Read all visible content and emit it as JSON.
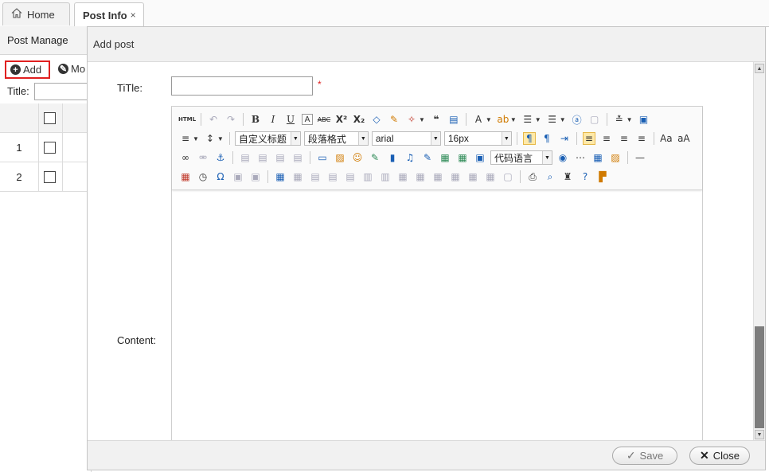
{
  "tabs": [
    {
      "label": "Home",
      "icon": "home-icon"
    },
    {
      "label": "Post Info",
      "close": "×"
    }
  ],
  "left_panel": {
    "title": "Post Manage",
    "add_label": "Add",
    "modify_label": "Mo",
    "filter_label": "Title:",
    "rows": [
      "1",
      "2"
    ]
  },
  "dialog": {
    "title": "Add post",
    "title_label": "TiTle:",
    "required_mark": "*",
    "content_label": "Content:",
    "save_label": "Save",
    "close_label": "Close"
  },
  "editor": {
    "html_button": "HTML",
    "custom_heading": "自定义标题",
    "paragraph_format": "段落格式",
    "font_family": "arial",
    "font_size": "16px",
    "code_language": "代码语言"
  }
}
